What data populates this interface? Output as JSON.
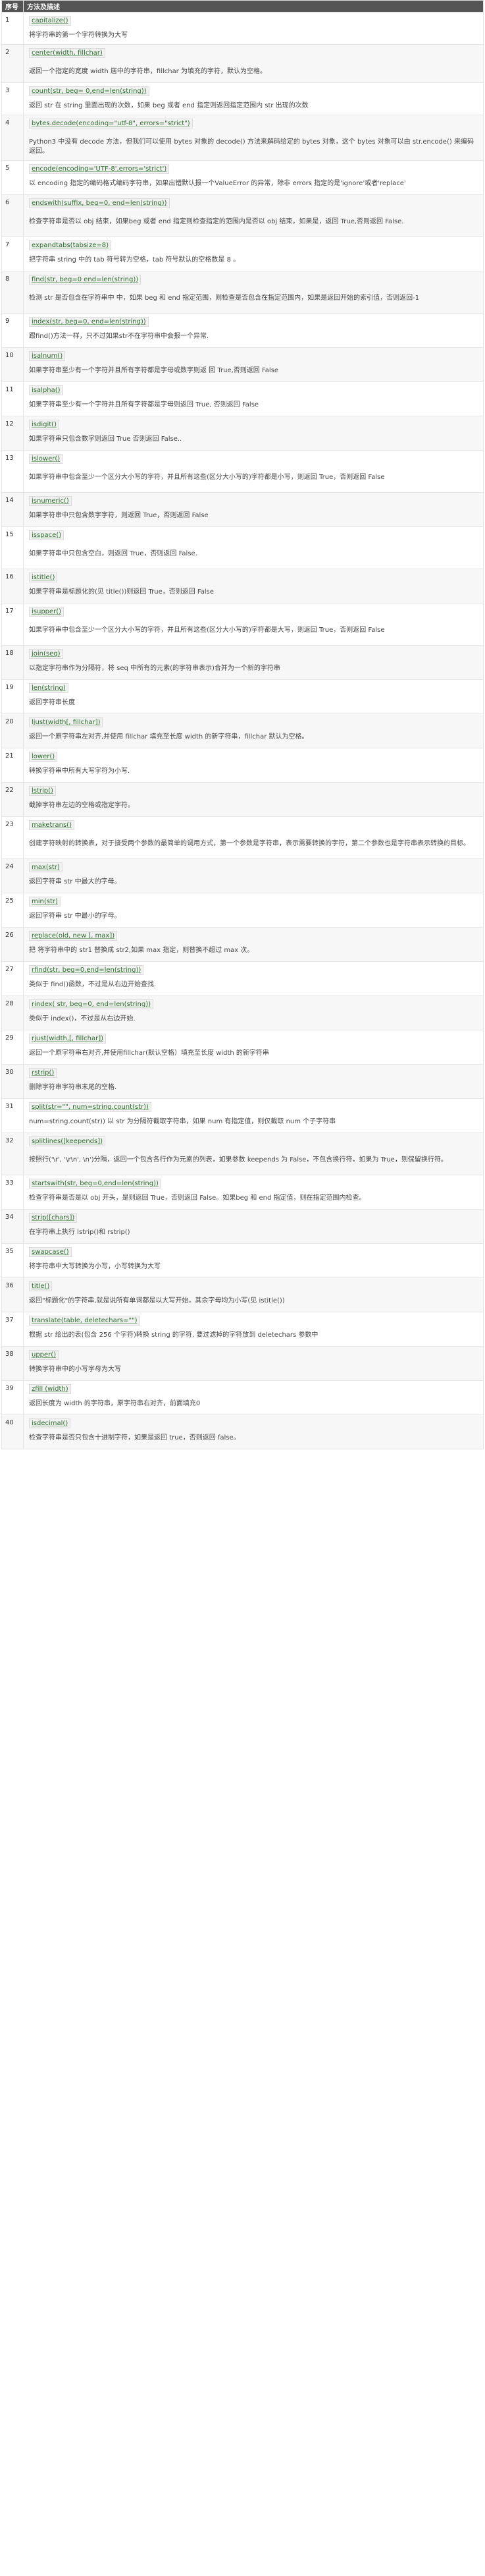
{
  "header": {
    "num": "序号",
    "desc": "方法及描述"
  },
  "methods": [
    {
      "num": "1",
      "code": "capitalize()",
      "text": "将字符串的第一个字符转换为大写"
    },
    {
      "num": "2",
      "code": "center(width, fillchar)",
      "text": "返回一个指定的宽度 width 居中的字符串，fillchar 为填充的字符，默认为空格。"
    },
    {
      "num": "3",
      "code": "count(str, beg= 0,end=len(string))",
      "text": "返回 str 在 string 里面出现的次数，如果 beg 或者 end 指定则返回指定范围内 str 出现的次数"
    },
    {
      "num": "4",
      "code": "bytes.decode(encoding=\"utf-8\", errors=\"strict\")",
      "text": "Python3 中没有 decode 方法，但我们可以使用 bytes 对象的 decode() 方法来解码给定的 bytes 对象，这个 bytes 对象可以由 str.encode() 来编码返回。"
    },
    {
      "num": "5",
      "code": "encode(encoding='UTF-8',errors='strict')",
      "text": "以 encoding 指定的编码格式编码字符串，如果出错默认报一个ValueError 的异常，除非 errors 指定的是'ignore'或者'replace'"
    },
    {
      "num": "6",
      "code": "endswith(suffix, beg=0, end=len(string))",
      "text": "检查字符串是否以 obj 结束，如果beg 或者 end 指定则检查指定的范围内是否以 obj 结束，如果是，返回 True,否则返回 False."
    },
    {
      "num": "7",
      "code": "expandtabs(tabsize=8)",
      "text": "把字符串 string 中的 tab 符号转为空格，tab 符号默认的空格数是 8 。"
    },
    {
      "num": "8",
      "code": "find(str, beg=0 end=len(string))",
      "text": "检测 str 是否包含在字符串中 中，如果 beg 和 end 指定范围，则检查是否包含在指定范围内，如果是返回开始的索引值，否则返回-1"
    },
    {
      "num": "9",
      "code": "index(str, beg=0, end=len(string))",
      "text": "跟find()方法一样，只不过如果str不在字符串中会报一个异常."
    },
    {
      "num": "10",
      "code": "isalnum()",
      "text": "如果字符串至少有一个字符并且所有字符都是字母或数字则返 回 True,否则返回 False"
    },
    {
      "num": "11",
      "code": "isalpha()",
      "text": "如果字符串至少有一个字符并且所有字符都是字母则返回 True, 否则返回 False"
    },
    {
      "num": "12",
      "code": "isdigit()",
      "text": "如果字符串只包含数字则返回 True 否则返回 False.."
    },
    {
      "num": "13",
      "code": "islower()",
      "text": "如果字符串中包含至少一个区分大小写的字符，并且所有这些(区分大小写的)字符都是小写，则返回 True，否则返回 False"
    },
    {
      "num": "14",
      "code": "isnumeric()",
      "text": "如果字符串中只包含数字字符，则返回 True，否则返回 False"
    },
    {
      "num": "15",
      "code": "isspace()",
      "text": "如果字符串中只包含空白，则返回 True，否则返回 False."
    },
    {
      "num": "16",
      "code": "istitle()",
      "text": "如果字符串是标题化的(见 title())则返回 True，否则返回 False"
    },
    {
      "num": "17",
      "code": "isupper()",
      "text": "如果字符串中包含至少一个区分大小写的字符，并且所有这些(区分大小写的)字符都是大写，则返回 True，否则返回 False"
    },
    {
      "num": "18",
      "code": "join(seq)",
      "text": "以指定字符串作为分隔符，将 seq 中所有的元素(的字符串表示)合并为一个新的字符串"
    },
    {
      "num": "19",
      "code": "len(string)",
      "text": "返回字符串长度"
    },
    {
      "num": "20",
      "code": "ljust(width[, fillchar])",
      "text": "返回一个原字符串左对齐,并使用 fillchar 填充至长度 width 的新字符串，fillchar 默认为空格。"
    },
    {
      "num": "21",
      "code": "lower()",
      "text": "转换字符串中所有大写字符为小写."
    },
    {
      "num": "22",
      "code": "lstrip()",
      "text": "截掉字符串左边的空格或指定字符。"
    },
    {
      "num": "23",
      "code": "maketrans()",
      "text": "创建字符映射的转换表，对于接受两个参数的最简单的调用方式，第一个参数是字符串，表示需要转换的字符，第二个参数也是字符串表示转换的目标。"
    },
    {
      "num": "24",
      "code": "max(str)",
      "text": "返回字符串 str 中最大的字母。"
    },
    {
      "num": "25",
      "code": "min(str)",
      "text": "返回字符串 str 中最小的字母。"
    },
    {
      "num": "26",
      "code": "replace(old, new [, max])",
      "text": "把 将字符串中的 str1 替换成 str2,如果 max 指定，则替换不超过 max 次。"
    },
    {
      "num": "27",
      "code": "rfind(str, beg=0,end=len(string))",
      "text": "类似于 find()函数，不过是从右边开始查找."
    },
    {
      "num": "28",
      "code": "rindex( str, beg=0, end=len(string))",
      "text": "类似于 index()，不过是从右边开始."
    },
    {
      "num": "29",
      "code": "rjust(width,[, fillchar])",
      "text": "返回一个原字符串右对齐,并使用fillchar(默认空格）填充至长度 width 的新字符串"
    },
    {
      "num": "30",
      "code": "rstrip()",
      "text": "删除字符串字符串末尾的空格."
    },
    {
      "num": "31",
      "code": "split(str=\"\", num=string.count(str))",
      "text": "num=string.count(str)) 以 str 为分隔符截取字符串，如果 num 有指定值，则仅截取 num 个子字符串"
    },
    {
      "num": "32",
      "code": "splitlines([keepends])",
      "text": "按照行('\\r', '\\r\\n', \\n')分隔，返回一个包含各行作为元素的列表，如果参数 keepends 为 False，不包含换行符，如果为 True，则保留换行符。"
    },
    {
      "num": "33",
      "code": "startswith(str, beg=0,end=len(string))",
      "text": "检查字符串是否是以 obj 开头，是则返回 True，否则返回 False。如果beg 和 end 指定值，则在指定范围内检查。"
    },
    {
      "num": "34",
      "code": "strip([chars])",
      "text": "在字符串上执行 lstrip()和 rstrip()"
    },
    {
      "num": "35",
      "code": "swapcase()",
      "text": "将字符串中大写转换为小写，小写转换为大写"
    },
    {
      "num": "36",
      "code": "title()",
      "text": "返回\"标题化\"的字符串,就是说所有单词都是以大写开始，其余字母均为小写(见 istitle())"
    },
    {
      "num": "37",
      "code": "translate(table, deletechars=\"\")",
      "text": "根据 str 给出的表(包含 256 个字符)转换 string 的字符, 要过滤掉的字符放到 deletechars 参数中"
    },
    {
      "num": "38",
      "code": "upper()",
      "text": "转换字符串中的小写字母为大写"
    },
    {
      "num": "39",
      "code": "zfill (width)",
      "text": "返回长度为 width 的字符串，原字符串右对齐，前面填充0"
    },
    {
      "num": "40",
      "code": "isdecimal()",
      "text": "检查字符串是否只包含十进制字符，如果是返回 true，否则返回 false。"
    }
  ]
}
